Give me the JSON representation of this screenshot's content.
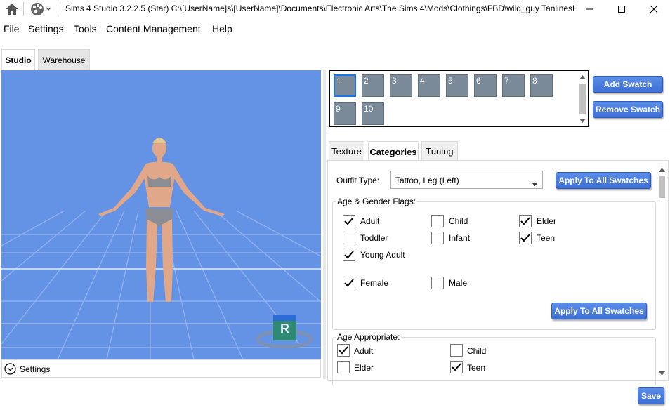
{
  "window": {
    "title": "Sims 4 Studio 3.2.2.5 (Star)  C:\\[UserName]s\\[UserName]\\Documents\\Electronic Arts\\The Sims 4\\Mods\\Clothings\\FBD\\wild_guy TanlinesBo"
  },
  "menu": [
    "File",
    "Settings",
    "Tools",
    "Content Management",
    "Help"
  ],
  "left_tabs": [
    "Studio",
    "Warehouse"
  ],
  "viewport": {
    "bottom_label": "Settings",
    "badge": "R"
  },
  "swatches": [
    "1",
    "2",
    "3",
    "4",
    "5",
    "6",
    "7",
    "8",
    "9",
    "10"
  ],
  "swatch_buttons": {
    "add": "Add Swatch",
    "remove": "Remove Swatch"
  },
  "right_tabs": [
    "Texture",
    "Categories",
    "Tuning"
  ],
  "categories": {
    "outfit_type_label": "Outfit Type:",
    "outfit_type_value": "Tattoo, Leg (Left)",
    "apply_all_1": "Apply To All Swatches",
    "age_gender_title": "Age & Gender Flags:",
    "flags": [
      {
        "label": "Adult",
        "checked": true
      },
      {
        "label": "Child",
        "checked": false
      },
      {
        "label": "Elder",
        "checked": true
      },
      {
        "label": "Toddler",
        "checked": false
      },
      {
        "label": "Infant",
        "checked": false
      },
      {
        "label": "Teen",
        "checked": true
      },
      {
        "label": "Young Adult",
        "checked": true
      },
      {
        "label": "Female",
        "checked": true
      },
      {
        "label": "Male",
        "checked": false
      }
    ],
    "apply_all_2": "Apply To All Swatches",
    "age_appropriate_title": "Age Appropriate:",
    "age_appropriate": [
      {
        "label": "Adult",
        "checked": true
      },
      {
        "label": "Child",
        "checked": false
      },
      {
        "label": "Elder",
        "checked": false
      },
      {
        "label": "Teen",
        "checked": true
      }
    ]
  },
  "save_label": "Save"
}
